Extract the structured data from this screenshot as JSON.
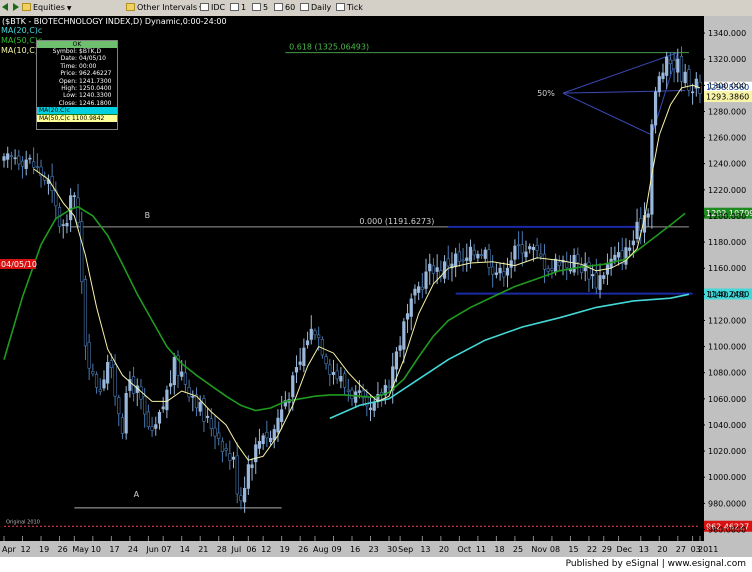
{
  "toolbar": {
    "items": [
      {
        "label": "Equities",
        "icon": "folder-icon"
      },
      {
        "label": "Other Intervals",
        "icon": "folder-icon"
      },
      {
        "label": "IDC",
        "icon": "square-icon"
      },
      {
        "label": "1",
        "icon": "square-icon"
      },
      {
        "label": "5",
        "icon": "square-icon"
      },
      {
        "label": "60",
        "icon": "square-icon"
      },
      {
        "label": "Daily",
        "icon": "square-icon"
      },
      {
        "label": "Tick",
        "icon": "square-icon"
      }
    ]
  },
  "chart_title": "($BTK - BIOTECHNOLOGY INDEX,D) Dynamic,0:00-24:00",
  "legend": {
    "ma20": "MA(20,C)c",
    "ma50": "MA(50,C)c",
    "ma10": "MA(10,C)c"
  },
  "data_window": {
    "header": "OK",
    "rows": [
      {
        "key": "Symbol",
        "value": "$BTK,D"
      },
      {
        "key": "Date",
        "value": "04/05/10"
      },
      {
        "key": "Time",
        "value": "00:00"
      },
      {
        "key": "Price",
        "value": "962.46227"
      },
      {
        "key": "Open",
        "value": "1241.7300"
      },
      {
        "key": "High",
        "value": "1250.0400"
      },
      {
        "key": "Low",
        "value": "1240.3300"
      },
      {
        "key": "Close",
        "value": "1246.1800"
      }
    ],
    "ma20_row": "MA(20,C)c",
    "ma50_row": "MA(50,C)c 1100.9842"
  },
  "chart_data": {
    "type": "ohlc-bar",
    "ylim": [
      955,
      1350
    ],
    "y_ticks": [
      960,
      980,
      1000,
      1020,
      1040,
      1060,
      1080,
      1100,
      1120,
      1140,
      1160,
      1180,
      1200,
      1220,
      1240,
      1260,
      1280,
      1300,
      1320,
      1340
    ],
    "y_tick_labels": [
      "960.0000",
      "980.0000",
      "1000.000",
      "1020.000",
      "1040.000",
      "1060.000",
      "1080.000",
      "1100.000",
      "1120.000",
      "1140.000",
      "1160.000",
      "1180.000",
      "1200.000",
      "1220.000",
      "1240.000",
      "1260.000",
      "1280.000",
      "1300.000",
      "1320.000",
      "1340.000"
    ],
    "x_labels": [
      {
        "label": "Apr",
        "day": 0
      },
      {
        "label": "12",
        "day": 5
      },
      {
        "label": "19",
        "day": 10
      },
      {
        "label": "26",
        "day": 15
      },
      {
        "label": "May",
        "day": 19
      },
      {
        "label": "10",
        "day": 24
      },
      {
        "label": "17",
        "day": 29
      },
      {
        "label": "24",
        "day": 34
      },
      {
        "label": "Jun",
        "day": 39
      },
      {
        "label": "07",
        "day": 43
      },
      {
        "label": "14",
        "day": 48
      },
      {
        "label": "21",
        "day": 53
      },
      {
        "label": "28",
        "day": 58
      },
      {
        "label": "Jul",
        "day": 62
      },
      {
        "label": "06",
        "day": 66
      },
      {
        "label": "12",
        "day": 70
      },
      {
        "label": "19",
        "day": 75
      },
      {
        "label": "26",
        "day": 80
      },
      {
        "label": "Aug",
        "day": 84
      },
      {
        "label": "09",
        "day": 89
      },
      {
        "label": "16",
        "day": 94
      },
      {
        "label": "23",
        "day": 99
      },
      {
        "label": "30",
        "day": 104
      },
      {
        "label": "Sep",
        "day": 107
      },
      {
        "label": "13",
        "day": 113
      },
      {
        "label": "20",
        "day": 118
      },
      {
        "label": "Oct",
        "day": 123
      },
      {
        "label": "11",
        "day": 128
      },
      {
        "label": "18",
        "day": 133
      },
      {
        "label": "25",
        "day": 138
      },
      {
        "label": "Nov",
        "day": 143
      },
      {
        "label": "08",
        "day": 148
      },
      {
        "label": "15",
        "day": 153
      },
      {
        "label": "22",
        "day": 158
      },
      {
        "label": "29",
        "day": 162
      },
      {
        "label": "Dec",
        "day": 166
      },
      {
        "label": "13",
        "day": 172
      },
      {
        "label": "20",
        "day": 177
      },
      {
        "label": "27",
        "day": 182
      },
      {
        "label": "03",
        "day": 186
      },
      {
        "label": "2011",
        "day": 188
      }
    ],
    "price_keypoints": [
      [
        0,
        1240
      ],
      [
        3,
        1246
      ],
      [
        6,
        1244
      ],
      [
        9,
        1236
      ],
      [
        12,
        1225
      ],
      [
        15,
        1195
      ],
      [
        17,
        1188
      ],
      [
        18,
        1222
      ],
      [
        19,
        1215
      ],
      [
        20,
        1190
      ],
      [
        22,
        1105
      ],
      [
        24,
        1075
      ],
      [
        26,
        1070
      ],
      [
        28,
        1090
      ],
      [
        30,
        1065
      ],
      [
        32,
        1040
      ],
      [
        34,
        1075
      ],
      [
        36,
        1065
      ],
      [
        38,
        1045
      ],
      [
        40,
        1030
      ],
      [
        42,
        1045
      ],
      [
        44,
        1065
      ],
      [
        46,
        1085
      ],
      [
        48,
        1080
      ],
      [
        50,
        1068
      ],
      [
        52,
        1060
      ],
      [
        54,
        1045
      ],
      [
        56,
        1040
      ],
      [
        58,
        1032
      ],
      [
        60,
        1020
      ],
      [
        62,
        1012
      ],
      [
        63,
        993
      ],
      [
        64,
        985
      ],
      [
        66,
        1010
      ],
      [
        68,
        1022
      ],
      [
        70,
        1036
      ],
      [
        72,
        1030
      ],
      [
        74,
        1045
      ],
      [
        76,
        1060
      ],
      [
        78,
        1072
      ],
      [
        80,
        1088
      ],
      [
        82,
        1108
      ],
      [
        84,
        1115
      ],
      [
        86,
        1100
      ],
      [
        88,
        1085
      ],
      [
        90,
        1078
      ],
      [
        92,
        1070
      ],
      [
        94,
        1065
      ],
      [
        96,
        1060
      ],
      [
        98,
        1048
      ],
      [
        100,
        1052
      ],
      [
        102,
        1065
      ],
      [
        104,
        1075
      ],
      [
        106,
        1095
      ],
      [
        108,
        1115
      ],
      [
        110,
        1130
      ],
      [
        112,
        1145
      ],
      [
        114,
        1155
      ],
      [
        116,
        1162
      ],
      [
        118,
        1158
      ],
      [
        120,
        1165
      ],
      [
        122,
        1168
      ],
      [
        124,
        1162
      ],
      [
        126,
        1170
      ],
      [
        128,
        1175
      ],
      [
        130,
        1172
      ],
      [
        132,
        1162
      ],
      [
        134,
        1155
      ],
      [
        136,
        1165
      ],
      [
        138,
        1172
      ],
      [
        140,
        1178
      ],
      [
        142,
        1175
      ],
      [
        144,
        1170
      ],
      [
        146,
        1165
      ],
      [
        148,
        1160
      ],
      [
        150,
        1168
      ],
      [
        152,
        1163
      ],
      [
        154,
        1166
      ],
      [
        156,
        1162
      ],
      [
        158,
        1158
      ],
      [
        160,
        1150
      ],
      [
        162,
        1158
      ],
      [
        164,
        1165
      ],
      [
        166,
        1168
      ],
      [
        168,
        1172
      ],
      [
        170,
        1182
      ],
      [
        172,
        1195
      ],
      [
        174,
        1208
      ],
      [
        175,
        1270
      ],
      [
        176,
        1292
      ],
      [
        177,
        1305
      ],
      [
        178,
        1312
      ],
      [
        180,
        1318
      ],
      [
        182,
        1315
      ],
      [
        184,
        1305
      ],
      [
        186,
        1300
      ],
      [
        188,
        1298
      ]
    ],
    "ma10_keypoints": [
      [
        8,
        1236
      ],
      [
        12,
        1228
      ],
      [
        16,
        1210
      ],
      [
        19,
        1200
      ],
      [
        22,
        1170
      ],
      [
        25,
        1130
      ],
      [
        28,
        1098
      ],
      [
        32,
        1078
      ],
      [
        36,
        1068
      ],
      [
        40,
        1058
      ],
      [
        44,
        1058
      ],
      [
        48,
        1066
      ],
      [
        52,
        1062
      ],
      [
        56,
        1050
      ],
      [
        60,
        1040
      ],
      [
        63,
        1025
      ],
      [
        66,
        1013
      ],
      [
        70,
        1016
      ],
      [
        74,
        1032
      ],
      [
        78,
        1055
      ],
      [
        82,
        1085
      ],
      [
        85,
        1100
      ],
      [
        89,
        1095
      ],
      [
        93,
        1080
      ],
      [
        97,
        1068
      ],
      [
        101,
        1058
      ],
      [
        104,
        1062
      ],
      [
        108,
        1090
      ],
      [
        112,
        1125
      ],
      [
        116,
        1148
      ],
      [
        120,
        1160
      ],
      [
        126,
        1164
      ],
      [
        132,
        1165
      ],
      [
        138,
        1162
      ],
      [
        144,
        1168
      ],
      [
        150,
        1166
      ],
      [
        156,
        1163
      ],
      [
        160,
        1158
      ],
      [
        164,
        1160
      ],
      [
        168,
        1166
      ],
      [
        171,
        1175
      ],
      [
        173,
        1198
      ],
      [
        175,
        1232
      ],
      [
        177,
        1262
      ],
      [
        180,
        1285
      ],
      [
        183,
        1298
      ],
      [
        186,
        1300
      ],
      [
        188,
        1298
      ]
    ],
    "ma50_keypoints": [
      [
        0,
        1090
      ],
      [
        5,
        1138
      ],
      [
        10,
        1178
      ],
      [
        14,
        1198
      ],
      [
        18,
        1205
      ],
      [
        20,
        1207
      ],
      [
        24,
        1200
      ],
      [
        28,
        1185
      ],
      [
        32,
        1163
      ],
      [
        36,
        1140
      ],
      [
        40,
        1120
      ],
      [
        44,
        1100
      ],
      [
        48,
        1087
      ],
      [
        52,
        1078
      ],
      [
        56,
        1070
      ],
      [
        60,
        1062
      ],
      [
        64,
        1055
      ],
      [
        68,
        1051
      ],
      [
        72,
        1053
      ],
      [
        76,
        1058
      ],
      [
        80,
        1060
      ],
      [
        84,
        1062
      ],
      [
        88,
        1063
      ],
      [
        92,
        1063
      ],
      [
        96,
        1062
      ],
      [
        100,
        1061
      ],
      [
        104,
        1065
      ],
      [
        108,
        1075
      ],
      [
        112,
        1092
      ],
      [
        116,
        1108
      ],
      [
        120,
        1120
      ],
      [
        126,
        1130
      ],
      [
        132,
        1138
      ],
      [
        138,
        1146
      ],
      [
        144,
        1152
      ],
      [
        150,
        1158
      ],
      [
        156,
        1161
      ],
      [
        162,
        1163
      ],
      [
        168,
        1167
      ],
      [
        174,
        1180
      ],
      [
        180,
        1193
      ],
      [
        184,
        1202
      ]
    ],
    "ma200_keypoints": [
      [
        88,
        1045
      ],
      [
        96,
        1055
      ],
      [
        104,
        1060
      ],
      [
        112,
        1075
      ],
      [
        120,
        1090
      ],
      [
        130,
        1105
      ],
      [
        140,
        1115
      ],
      [
        150,
        1122
      ],
      [
        160,
        1130
      ],
      [
        170,
        1135
      ],
      [
        180,
        1137
      ],
      [
        185,
        1140
      ]
    ],
    "annotations": {
      "fib_618": "0.618 (1325.06493)",
      "fib_0": "0.000 (1191.6273)",
      "label_b": "B",
      "label_a": "A",
      "label_50pct": "50%",
      "fib_618_value": 1325.06493,
      "fib_0_value": 1191.6273
    },
    "lines": {
      "fib_618": {
        "value": 1325.06493,
        "from_day": 76,
        "to_day": 185
      },
      "fib_0": {
        "value": 1191.6273,
        "from_day": 18,
        "to_day": 185
      },
      "low_a": {
        "value": 976.5,
        "from_day": 19,
        "to_day": 75
      },
      "channel_top": {
        "value": 1191.6,
        "from_day": 120,
        "to_day": 172
      },
      "channel_bottom": {
        "value": 1140.5,
        "from_day": 122,
        "to_day": 186
      },
      "fan_apex": {
        "day": 151,
        "value": 1294
      },
      "fan_ends": [
        [
          182,
          1325
        ],
        [
          184,
          1296
        ],
        [
          175,
          1262
        ]
      ]
    },
    "price_labels": {
      "current": "1298.5560",
      "current_value": 1298.556,
      "ma10": "1293.3860",
      "ma10_value": 1293.386,
      "ma50": "1202.10709",
      "ma50_value": 1202.10709,
      "ma200": "1140.2480",
      "ma200_value": 1140.248,
      "cursor": "962.46227",
      "cursor_value": 962.46227
    },
    "cursor_date": "04/05/10",
    "axis_note": "Original 2010",
    "colors": {
      "background": "#000000",
      "bar": "#9ab8dc",
      "bar_down": "#4a7ab0",
      "ma10": "#f8f4a8",
      "ma50": "#1f9a1f",
      "ma200": "#44d8d8",
      "fib": "#4a9a4a",
      "channel": "#1a2aa8",
      "fan": "#3a4ab8",
      "cursor_line": "#ff4040"
    }
  },
  "footer": "Published by eSignal | www.esignal.com"
}
